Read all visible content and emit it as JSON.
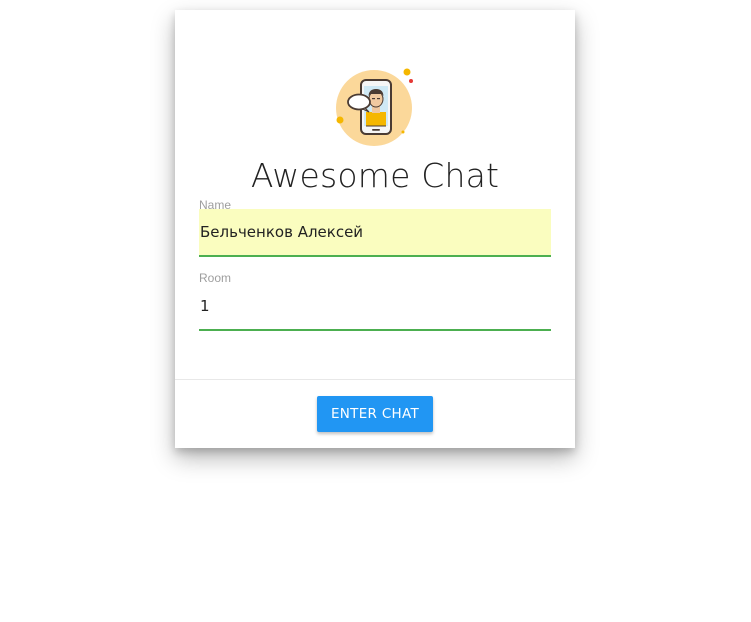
{
  "app": {
    "title": "Awesome Chat",
    "logo_icon": "phone-chat-avatar-icon"
  },
  "form": {
    "name": {
      "label": "Name",
      "value": "Бельченков Алексей"
    },
    "room": {
      "label": "Room",
      "value": "1"
    }
  },
  "actions": {
    "enter_label": "ENTER CHAT"
  },
  "colors": {
    "accent_button": "#2196f3",
    "input_underline": "#4caf50",
    "autofill_background": "#fafdbf",
    "logo_circle": "#fbd89a"
  }
}
